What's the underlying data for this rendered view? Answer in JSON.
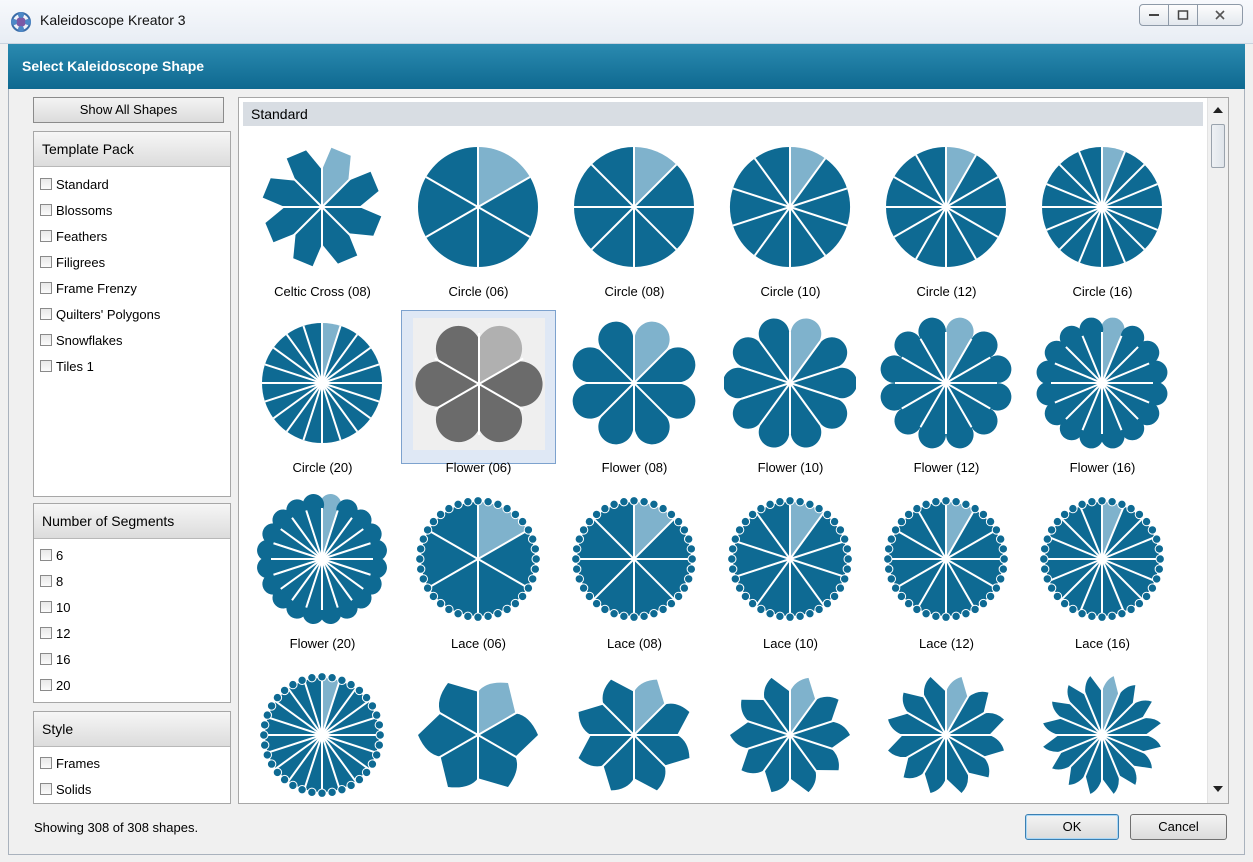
{
  "window": {
    "title": "Kaleidoscope Kreator 3"
  },
  "header": {
    "title": "Select Kaleidoscope Shape"
  },
  "sidebar": {
    "show_all_label": "Show All Shapes",
    "template_pack": {
      "title": "Template Pack",
      "items": [
        "Standard",
        "Blossoms",
        "Feathers",
        "Filigrees",
        "Frame Frenzy",
        "Quilters' Polygons",
        "Snowflakes",
        "Tiles 1"
      ]
    },
    "segments": {
      "title": "Number of Segments",
      "items": [
        "6",
        "8",
        "10",
        "12",
        "16",
        "20"
      ]
    },
    "style": {
      "title": "Style",
      "items": [
        "Frames",
        "Solids"
      ]
    }
  },
  "gallery": {
    "group_title": "Standard",
    "selected": "Flower (06)",
    "shapes": [
      {
        "label": "Celtic Cross (08)",
        "kind": "celtic",
        "n": 8
      },
      {
        "label": "Circle (06)",
        "kind": "circle",
        "n": 6
      },
      {
        "label": "Circle (08)",
        "kind": "circle",
        "n": 8
      },
      {
        "label": "Circle (10)",
        "kind": "circle",
        "n": 10
      },
      {
        "label": "Circle (12)",
        "kind": "circle",
        "n": 12
      },
      {
        "label": "Circle (16)",
        "kind": "circle",
        "n": 16
      },
      {
        "label": "Circle (20)",
        "kind": "circle",
        "n": 20
      },
      {
        "label": "Flower (06)",
        "kind": "flower",
        "n": 6
      },
      {
        "label": "Flower (08)",
        "kind": "flower",
        "n": 8
      },
      {
        "label": "Flower (10)",
        "kind": "flower",
        "n": 10
      },
      {
        "label": "Flower (12)",
        "kind": "flower",
        "n": 12
      },
      {
        "label": "Flower (16)",
        "kind": "flower",
        "n": 16
      },
      {
        "label": "Flower (20)",
        "kind": "flower",
        "n": 20
      },
      {
        "label": "Lace (06)",
        "kind": "lace",
        "n": 6
      },
      {
        "label": "Lace (08)",
        "kind": "lace",
        "n": 8
      },
      {
        "label": "Lace (10)",
        "kind": "lace",
        "n": 10
      },
      {
        "label": "Lace (12)",
        "kind": "lace",
        "n": 12
      },
      {
        "label": "Lace (16)",
        "kind": "lace",
        "n": 16
      },
      {
        "label": "",
        "kind": "lace",
        "n": 20
      },
      {
        "label": "",
        "kind": "scallop",
        "n": 6
      },
      {
        "label": "",
        "kind": "scallop",
        "n": 8
      },
      {
        "label": "",
        "kind": "scallop",
        "n": 10
      },
      {
        "label": "",
        "kind": "scallop",
        "n": 12
      },
      {
        "label": "",
        "kind": "scallop",
        "n": 16
      }
    ]
  },
  "colors": {
    "shape": "#0e6a93",
    "highlight": "#7fb2cc",
    "selected_shape": "#6b6b6b",
    "selected_highlight": "#b0b0b0"
  },
  "status_text": "Showing 308 of 308 shapes.",
  "buttons": {
    "ok": "OK",
    "cancel": "Cancel"
  }
}
